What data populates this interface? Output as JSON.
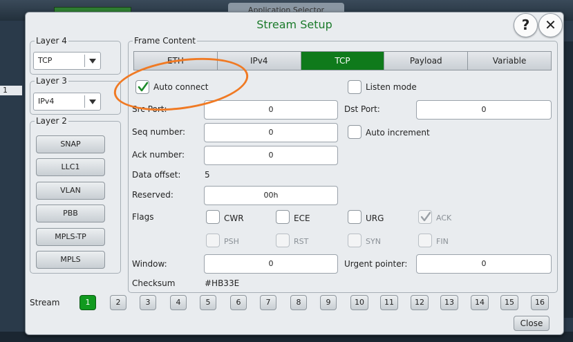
{
  "background": {
    "app_selector_label": "Application Selector",
    "left_row_number": "1"
  },
  "dialog": {
    "title": "Stream Setup",
    "help_label": "?",
    "close_x_label": "✕"
  },
  "layer4": {
    "legend": "Layer 4",
    "value": "TCP"
  },
  "layer3": {
    "legend": "Layer 3",
    "value": "IPv4"
  },
  "layer2": {
    "legend": "Layer 2",
    "buttons": [
      "SNAP",
      "LLC1",
      "VLAN",
      "PBB",
      "MPLS-TP",
      "MPLS"
    ]
  },
  "frame": {
    "legend": "Frame Content",
    "tabs": [
      "ETH",
      "IPv4",
      "TCP",
      "Payload",
      "Variable"
    ],
    "active_tab": "TCP",
    "auto_connect_label": "Auto connect",
    "listen_mode_label": "Listen mode",
    "src_port_label": "Src Port:",
    "src_port_value": "0",
    "dst_port_label": "Dst Port:",
    "dst_port_value": "0",
    "seq_label": "Seq number:",
    "seq_value": "0",
    "auto_increment_label": "Auto increment",
    "ack_label": "Ack number:",
    "ack_value": "0",
    "data_offset_label": "Data offset:",
    "data_offset_value": "5",
    "reserved_label": "Reserved:",
    "reserved_value": "00h",
    "flags_label": "Flags",
    "flags": {
      "cwr": "CWR",
      "ece": "ECE",
      "urg": "URG",
      "ack": "ACK",
      "psh": "PSH",
      "rst": "RST",
      "syn": "SYN",
      "fin": "FIN"
    },
    "window_label": "Window:",
    "window_value": "0",
    "urgent_label": "Urgent pointer:",
    "urgent_value": "0",
    "checksum_label": "Checksum",
    "checksum_value": "#HB33E"
  },
  "stream": {
    "label": "Stream",
    "numbers": [
      "1",
      "2",
      "3",
      "4",
      "5",
      "6",
      "7",
      "8",
      "9",
      "10",
      "11",
      "12",
      "13",
      "14",
      "15",
      "16"
    ],
    "active": "1"
  },
  "close_label": "Close",
  "colors": {
    "accent_green": "#0f7a1b",
    "title_green": "#1a7a2a",
    "annotation_orange": "#f07a24"
  }
}
